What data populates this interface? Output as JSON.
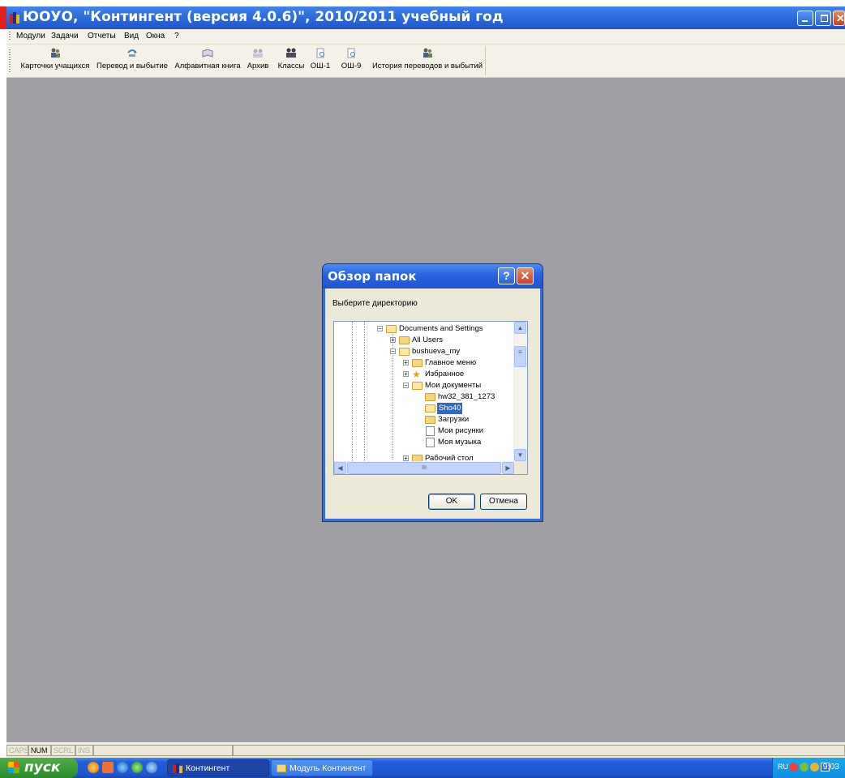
{
  "window": {
    "title": "ЮОУО, \"Контингент (версия 4.0.6)\", 2010/2011 учебный год"
  },
  "menu": [
    "Модули",
    "Задачи",
    "Отчеты",
    "Вид",
    "Окна",
    "?"
  ],
  "toolbar": [
    {
      "label": "Карточки учащихся",
      "icon": "students-icon"
    },
    {
      "label": "Перевод и выбытие",
      "icon": "transfer-icon"
    },
    {
      "label": "Алфавитная книга",
      "icon": "book-icon"
    },
    {
      "label": "Архив",
      "icon": "archive-icon"
    },
    {
      "label": "Классы",
      "icon": "classes-icon"
    },
    {
      "label": "ОШ-1",
      "icon": "report-icon"
    },
    {
      "label": "ОШ-9",
      "icon": "report-icon"
    },
    {
      "label": "История переводов и выбытий",
      "icon": "history-icon"
    }
  ],
  "statusbar": [
    "CAPS",
    "NUM",
    "SCRL",
    "INS"
  ],
  "statusbar_active": "NUM",
  "dialog": {
    "title": "Обзор папок",
    "help_label": "?",
    "prompt": "Выберите директорию",
    "tree": [
      {
        "label": "Documents and Settings",
        "level": 0,
        "expander": "⊟"
      },
      {
        "label": "All Users",
        "level": 1,
        "expander": "⊞"
      },
      {
        "label": "bushueva_my",
        "level": 1,
        "expander": "⊟"
      },
      {
        "label": "Главное меню",
        "level": 2,
        "expander": "⊞"
      },
      {
        "label": "Избранное",
        "level": 2,
        "expander": "⊞"
      },
      {
        "label": "Мои документы",
        "level": 2,
        "expander": "⊟"
      },
      {
        "label": "hw32_381_1273",
        "level": 3,
        "expander": ""
      },
      {
        "label": "Sho40",
        "level": 3,
        "expander": "",
        "selected": true
      },
      {
        "label": "Загрузки",
        "level": 3,
        "expander": ""
      },
      {
        "label": "Мои рисунки",
        "level": 3,
        "expander": ""
      },
      {
        "label": "Моя музыка",
        "level": 3,
        "expander": ""
      },
      {
        "label": "Рабочий стол",
        "level": 2,
        "expander": "⊞"
      }
    ],
    "scroll_marker": "III",
    "ok_label": "OK",
    "cancel_label": "Отмена"
  },
  "taskbar": {
    "start_label": "пуск",
    "tasks": [
      {
        "label": "Контингент",
        "active": true
      },
      {
        "label": "Модуль Контингент",
        "active": false
      }
    ],
    "lang": "RU",
    "clock": "9:03"
  },
  "colors": {
    "xp_blue": "#245edb",
    "workspace": "#a09fa4",
    "start_green": "#3a9c38",
    "selection": "#316ac5"
  }
}
